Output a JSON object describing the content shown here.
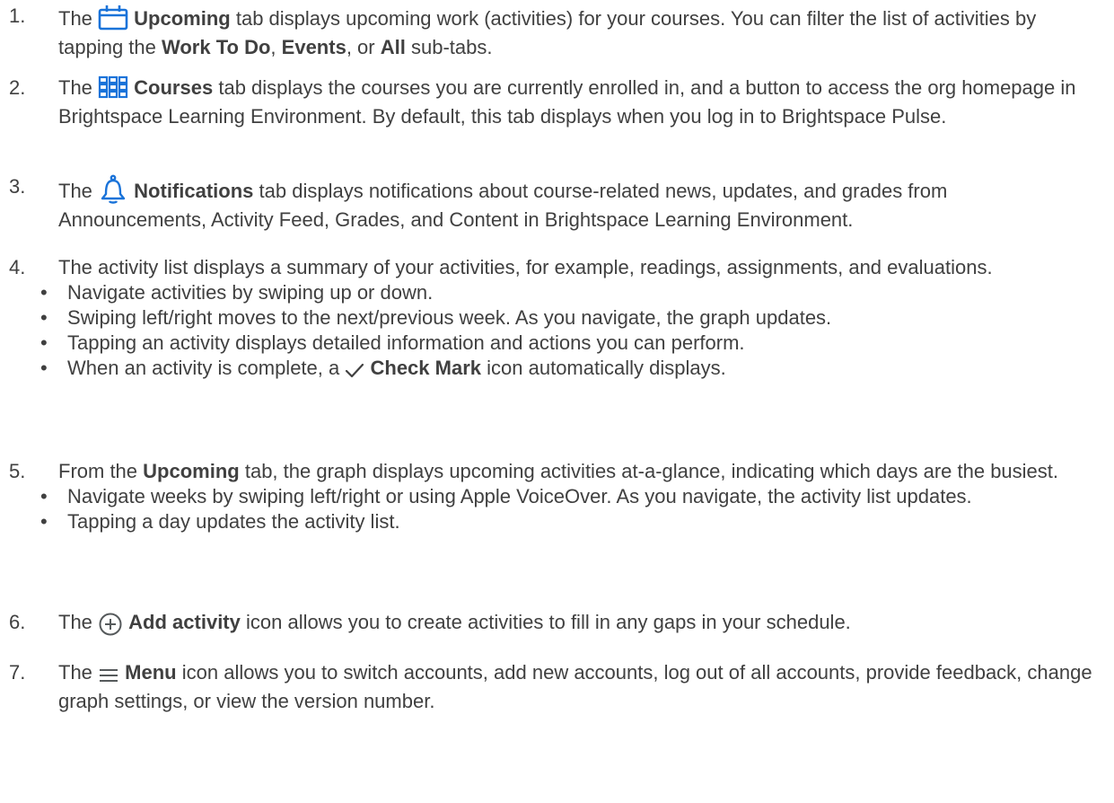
{
  "items": [
    {
      "num": "1.",
      "pre": "The",
      "icon": "calendar-icon",
      "strong": "Upcoming",
      "post": "tab displays upcoming work (activities) for your courses. You can filter the list of activities by tapping the",
      "subtab_1": "Work To Do",
      "sep_1": ",",
      "subtab_2": "Events",
      "sep_2": ", or",
      "subtab_3": "All",
      "end": "sub-tabs."
    },
    {
      "num": "2.",
      "pre": "The",
      "icon": "grid-icon",
      "strong": "Courses",
      "post": "tab displays the courses you are currently enrolled in, and a button to access the org homepage in Brightspace Learning Environment. By default, this tab displays when you log in to Brightspace Pulse."
    },
    {
      "num": "3.",
      "pre": "The",
      "icon": "bell-icon",
      "strong": "Notifications",
      "post": "tab displays notifications about course-related news, updates, and grades from Announcements, Activity Feed, Grades, and Content in Brightspace Learning Environment."
    },
    {
      "num": "4.",
      "text": "The activity list displays a summary of your activities, for example, readings, assignments, and evaluations.",
      "bullets": [
        "Navigate activities by swiping up or down.",
        "Swiping left/right moves to the next/previous week. As you navigate, the graph updates.",
        "Tapping an activity displays detailed information and actions you can perform."
      ],
      "last_bullet": {
        "pre": "When an activity is complete, a",
        "icon": "check-mark-icon",
        "strong": "Check Mark",
        "post": "icon automatically displays."
      }
    },
    {
      "num": "5.",
      "pre": "From the",
      "strong": "Upcoming",
      "post": "tab, the graph displays upcoming activities at-a-glance, indicating which days are the busiest.",
      "bullets": [
        "Navigate weeks by swiping left/right or using Apple VoiceOver. As you navigate, the activity list updates.",
        "Tapping a day updates the activity list."
      ]
    },
    {
      "num": "6.",
      "pre": "The",
      "icon": "add-circle-icon",
      "strong": "Add activity",
      "post": "icon allows you to create activities to fill in any gaps in your schedule."
    },
    {
      "num": "7.",
      "pre": "The",
      "icon": "menu-icon",
      "strong": "Menu",
      "post": "icon allows you to switch accounts, add new accounts, log out of all accounts, provide feedback, change graph settings, or view the version number."
    }
  ],
  "bullet_glyph": "•",
  "colors": {
    "text": "#404040",
    "icon_blue": "#1a73d9",
    "icon_gray": "#565a5c"
  }
}
